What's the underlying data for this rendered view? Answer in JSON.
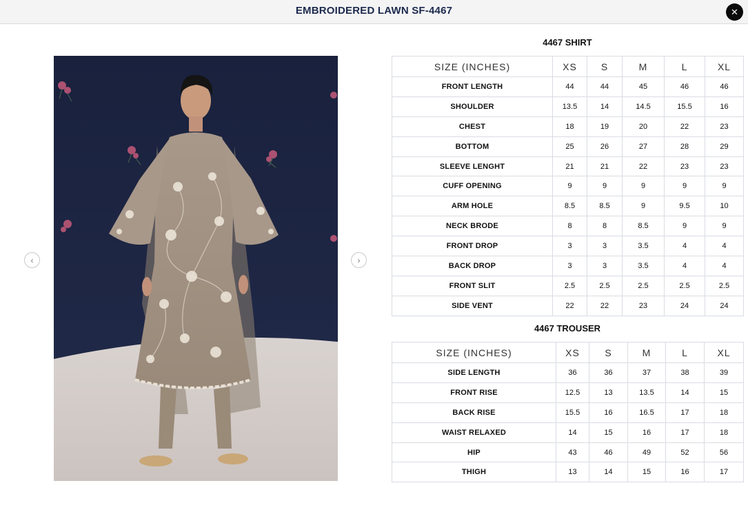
{
  "header": {
    "title": "EMBROIDERED LAWN SF-4467"
  },
  "icons": {
    "close": "close-icon",
    "prev": "chevron-left-icon",
    "next": "chevron-right-icon"
  },
  "nav": {
    "prev_glyph": "‹",
    "next_glyph": "›",
    "close_glyph": "✕"
  },
  "shirt": {
    "title": "4467 SHIRT",
    "headers": [
      "SIZE (INCHES)",
      "XS",
      "S",
      "M",
      "L",
      "XL"
    ],
    "rows": [
      [
        "FRONT LENGTH",
        "44",
        "44",
        "45",
        "46",
        "46"
      ],
      [
        "SHOULDER",
        "13.5",
        "14",
        "14.5",
        "15.5",
        "16"
      ],
      [
        "CHEST",
        "18",
        "19",
        "20",
        "22",
        "23"
      ],
      [
        "BOTTOM",
        "25",
        "26",
        "27",
        "28",
        "29"
      ],
      [
        "SLEEVE LENGHT",
        "21",
        "21",
        "22",
        "23",
        "23"
      ],
      [
        "CUFF OPENING",
        "9",
        "9",
        "9",
        "9",
        "9"
      ],
      [
        "ARM HOLE",
        "8.5",
        "8.5",
        "9",
        "9.5",
        "10"
      ],
      [
        "NECK BRODE",
        "8",
        "8",
        "8.5",
        "9",
        "9"
      ],
      [
        "FRONT DROP",
        "3",
        "3",
        "3.5",
        "4",
        "4"
      ],
      [
        "BACK DROP",
        "3",
        "3",
        "3.5",
        "4",
        "4"
      ],
      [
        "FRONT SLIT",
        "2.5",
        "2.5",
        "2.5",
        "2.5",
        "2.5"
      ],
      [
        "SIDE VENT",
        "22",
        "22",
        "23",
        "24",
        "24"
      ]
    ]
  },
  "trouser": {
    "title": "4467 TROUSER",
    "headers": [
      "SIZE (INCHES)",
      "XS",
      "S",
      "M",
      "L",
      "XL"
    ],
    "rows": [
      [
        "SIDE LENGTH",
        "36",
        "36",
        "37",
        "38",
        "39"
      ],
      [
        "FRONT RISE",
        "12.5",
        "13",
        "13.5",
        "14",
        "15"
      ],
      [
        "BACK RISE",
        "15.5",
        "16",
        "16.5",
        "17",
        "18"
      ],
      [
        "WAIST RELAXED",
        "14",
        "15",
        "16",
        "17",
        "18"
      ],
      [
        "HIP",
        "43",
        "46",
        "49",
        "52",
        "56"
      ],
      [
        "THIGH",
        "13",
        "14",
        "15",
        "16",
        "17"
      ]
    ]
  },
  "colors": {
    "header_bg": "#f4f4f5",
    "title": "#1c2a4d",
    "backdrop": "#1b2340",
    "garment": "#a39382",
    "border": "#d9dce3"
  }
}
